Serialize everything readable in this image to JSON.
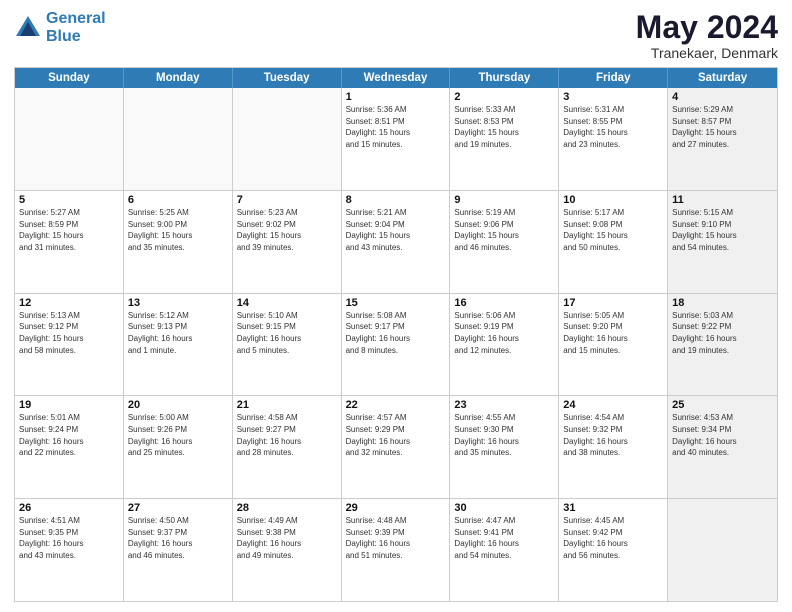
{
  "header": {
    "logo_line1": "General",
    "logo_line2": "Blue",
    "month": "May 2024",
    "location": "Tranekaer, Denmark"
  },
  "weekdays": [
    "Sunday",
    "Monday",
    "Tuesday",
    "Wednesday",
    "Thursday",
    "Friday",
    "Saturday"
  ],
  "rows": [
    [
      {
        "day": "",
        "info": "",
        "empty": true
      },
      {
        "day": "",
        "info": "",
        "empty": true
      },
      {
        "day": "",
        "info": "",
        "empty": true
      },
      {
        "day": "1",
        "info": "Sunrise: 5:36 AM\nSunset: 8:51 PM\nDaylight: 15 hours\nand 15 minutes."
      },
      {
        "day": "2",
        "info": "Sunrise: 5:33 AM\nSunset: 8:53 PM\nDaylight: 15 hours\nand 19 minutes."
      },
      {
        "day": "3",
        "info": "Sunrise: 5:31 AM\nSunset: 8:55 PM\nDaylight: 15 hours\nand 23 minutes."
      },
      {
        "day": "4",
        "info": "Sunrise: 5:29 AM\nSunset: 8:57 PM\nDaylight: 15 hours\nand 27 minutes.",
        "shaded": true
      }
    ],
    [
      {
        "day": "5",
        "info": "Sunrise: 5:27 AM\nSunset: 8:59 PM\nDaylight: 15 hours\nand 31 minutes."
      },
      {
        "day": "6",
        "info": "Sunrise: 5:25 AM\nSunset: 9:00 PM\nDaylight: 15 hours\nand 35 minutes."
      },
      {
        "day": "7",
        "info": "Sunrise: 5:23 AM\nSunset: 9:02 PM\nDaylight: 15 hours\nand 39 minutes."
      },
      {
        "day": "8",
        "info": "Sunrise: 5:21 AM\nSunset: 9:04 PM\nDaylight: 15 hours\nand 43 minutes."
      },
      {
        "day": "9",
        "info": "Sunrise: 5:19 AM\nSunset: 9:06 PM\nDaylight: 15 hours\nand 46 minutes."
      },
      {
        "day": "10",
        "info": "Sunrise: 5:17 AM\nSunset: 9:08 PM\nDaylight: 15 hours\nand 50 minutes."
      },
      {
        "day": "11",
        "info": "Sunrise: 5:15 AM\nSunset: 9:10 PM\nDaylight: 15 hours\nand 54 minutes.",
        "shaded": true
      }
    ],
    [
      {
        "day": "12",
        "info": "Sunrise: 5:13 AM\nSunset: 9:12 PM\nDaylight: 15 hours\nand 58 minutes."
      },
      {
        "day": "13",
        "info": "Sunrise: 5:12 AM\nSunset: 9:13 PM\nDaylight: 16 hours\nand 1 minute."
      },
      {
        "day": "14",
        "info": "Sunrise: 5:10 AM\nSunset: 9:15 PM\nDaylight: 16 hours\nand 5 minutes."
      },
      {
        "day": "15",
        "info": "Sunrise: 5:08 AM\nSunset: 9:17 PM\nDaylight: 16 hours\nand 8 minutes."
      },
      {
        "day": "16",
        "info": "Sunrise: 5:06 AM\nSunset: 9:19 PM\nDaylight: 16 hours\nand 12 minutes."
      },
      {
        "day": "17",
        "info": "Sunrise: 5:05 AM\nSunset: 9:20 PM\nDaylight: 16 hours\nand 15 minutes."
      },
      {
        "day": "18",
        "info": "Sunrise: 5:03 AM\nSunset: 9:22 PM\nDaylight: 16 hours\nand 19 minutes.",
        "shaded": true
      }
    ],
    [
      {
        "day": "19",
        "info": "Sunrise: 5:01 AM\nSunset: 9:24 PM\nDaylight: 16 hours\nand 22 minutes."
      },
      {
        "day": "20",
        "info": "Sunrise: 5:00 AM\nSunset: 9:26 PM\nDaylight: 16 hours\nand 25 minutes."
      },
      {
        "day": "21",
        "info": "Sunrise: 4:58 AM\nSunset: 9:27 PM\nDaylight: 16 hours\nand 28 minutes."
      },
      {
        "day": "22",
        "info": "Sunrise: 4:57 AM\nSunset: 9:29 PM\nDaylight: 16 hours\nand 32 minutes."
      },
      {
        "day": "23",
        "info": "Sunrise: 4:55 AM\nSunset: 9:30 PM\nDaylight: 16 hours\nand 35 minutes."
      },
      {
        "day": "24",
        "info": "Sunrise: 4:54 AM\nSunset: 9:32 PM\nDaylight: 16 hours\nand 38 minutes."
      },
      {
        "day": "25",
        "info": "Sunrise: 4:53 AM\nSunset: 9:34 PM\nDaylight: 16 hours\nand 40 minutes.",
        "shaded": true
      }
    ],
    [
      {
        "day": "26",
        "info": "Sunrise: 4:51 AM\nSunset: 9:35 PM\nDaylight: 16 hours\nand 43 minutes."
      },
      {
        "day": "27",
        "info": "Sunrise: 4:50 AM\nSunset: 9:37 PM\nDaylight: 16 hours\nand 46 minutes."
      },
      {
        "day": "28",
        "info": "Sunrise: 4:49 AM\nSunset: 9:38 PM\nDaylight: 16 hours\nand 49 minutes."
      },
      {
        "day": "29",
        "info": "Sunrise: 4:48 AM\nSunset: 9:39 PM\nDaylight: 16 hours\nand 51 minutes."
      },
      {
        "day": "30",
        "info": "Sunrise: 4:47 AM\nSunset: 9:41 PM\nDaylight: 16 hours\nand 54 minutes."
      },
      {
        "day": "31",
        "info": "Sunrise: 4:45 AM\nSunset: 9:42 PM\nDaylight: 16 hours\nand 56 minutes."
      },
      {
        "day": "",
        "info": "",
        "empty": true,
        "shaded": true
      }
    ]
  ]
}
